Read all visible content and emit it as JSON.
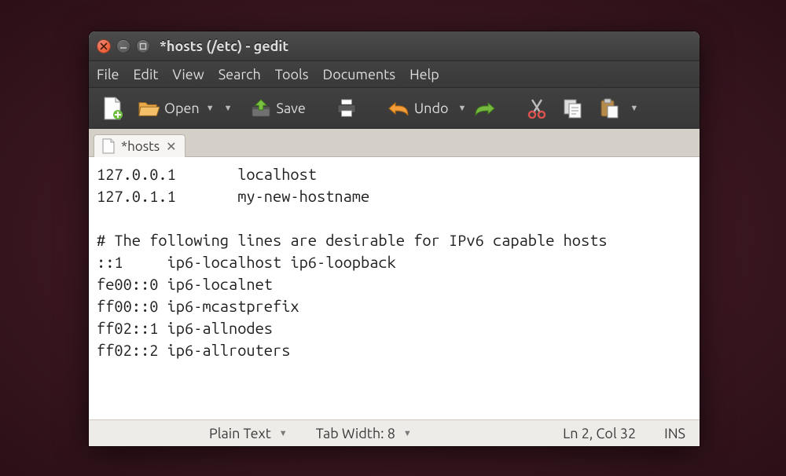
{
  "window": {
    "title": "*hosts (/etc) - gedit"
  },
  "menu": {
    "file": "File",
    "edit": "Edit",
    "view": "View",
    "search": "Search",
    "tools": "Tools",
    "documents": "Documents",
    "help": "Help"
  },
  "toolbar": {
    "open": "Open",
    "save": "Save",
    "undo": "Undo"
  },
  "tabs": [
    {
      "label": "*hosts"
    }
  ],
  "editor": {
    "content": "127.0.0.1       localhost\n127.0.1.1       my-new-hostname\n\n# The following lines are desirable for IPv6 capable hosts\n::1     ip6-localhost ip6-loopback\nfe00::0 ip6-localnet\nff00::0 ip6-mcastprefix\nff02::1 ip6-allnodes\nff02::2 ip6-allrouters"
  },
  "status": {
    "language": "Plain Text",
    "tabwidth": "Tab Width: 8",
    "position": "Ln 2, Col 32",
    "mode": "INS"
  }
}
